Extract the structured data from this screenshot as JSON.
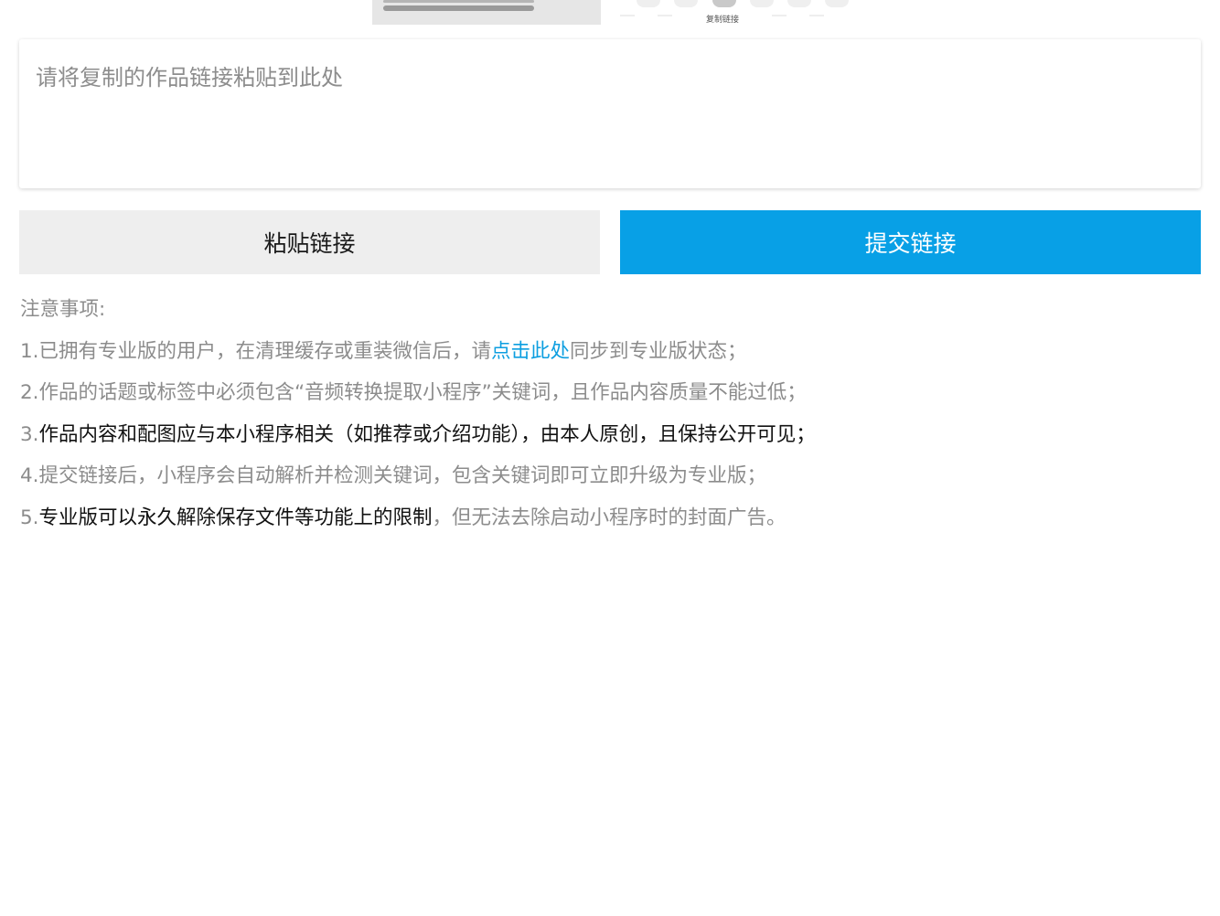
{
  "tutorial": {
    "copy_link_label": "复制链接"
  },
  "link_input": {
    "placeholder": "请将复制的作品链接粘贴到此处",
    "value": ""
  },
  "buttons": {
    "paste_label": "粘贴链接",
    "submit_label": "提交链接"
  },
  "notes": {
    "heading": "注意事项:",
    "items": [
      {
        "number": "1.",
        "before_link": "已拥有专业版的用户，在清理缓存或重装微信后，请",
        "link_text": "点击此处",
        "after_link": "同步到专业版状态；"
      },
      {
        "number": "2.",
        "text": "作品的话题或标签中必须包含“音频转换提取小程序”关键词，且作品内容质量不能过低；"
      },
      {
        "number": "3.",
        "text": "作品内容和配图应与本小程序相关（如推荐或介绍功能），由本人原创，且保持公开可见；"
      },
      {
        "number": "4.",
        "text": "提交链接后，小程序会自动解析并检测关键词，包含关键词即可立即升级为专业版；"
      },
      {
        "number": "5.",
        "highlight": "专业版可以永久解除保存文件等功能上的限制",
        "rest": "，但无法去除启动小程序时的封面广告。"
      }
    ]
  },
  "colors": {
    "primary": "#08a0e6",
    "link": "#0c9ee0",
    "secondary_button": "#eeeeee",
    "muted_text": "#8c8c8c",
    "dark_text": "#111111"
  }
}
